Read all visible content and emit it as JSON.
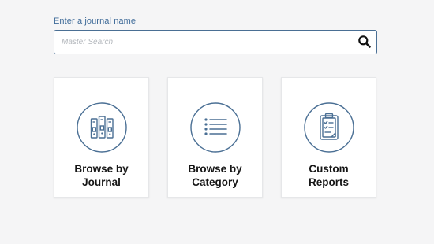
{
  "search": {
    "label": "Enter a journal name",
    "placeholder": "Master Search",
    "value": ""
  },
  "cards": [
    {
      "label": "Browse by\nJournal",
      "icon": "binders-icon"
    },
    {
      "label": "Browse by\nCategory",
      "icon": "list-icon"
    },
    {
      "label": "Custom\nReports",
      "icon": "clipboard-icon"
    }
  ],
  "colors": {
    "accent": "#3f6b99",
    "icon_stroke": "#4a6f94",
    "background": "#f5f5f6"
  }
}
